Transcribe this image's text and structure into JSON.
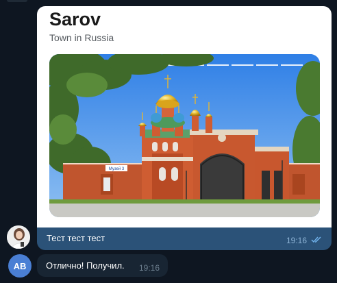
{
  "link_preview": {
    "title": "Sarov",
    "subtitle": "Town in Russia",
    "image_alt": "Cathedral with golden domes",
    "sign_text": "Музей 3"
  },
  "messages": [
    {
      "text": "Тест тест тест",
      "time": "19:16",
      "status": "read",
      "avatar": "photo"
    },
    {
      "text": "Отлично! Получил.",
      "time": "19:16",
      "avatar_initials": "AB"
    }
  ],
  "colors": {
    "background": "#0e1621",
    "outgoing_bubble": "#2b5278",
    "incoming_bubble": "#182533",
    "avatar_ab": "#4a7fd4"
  }
}
